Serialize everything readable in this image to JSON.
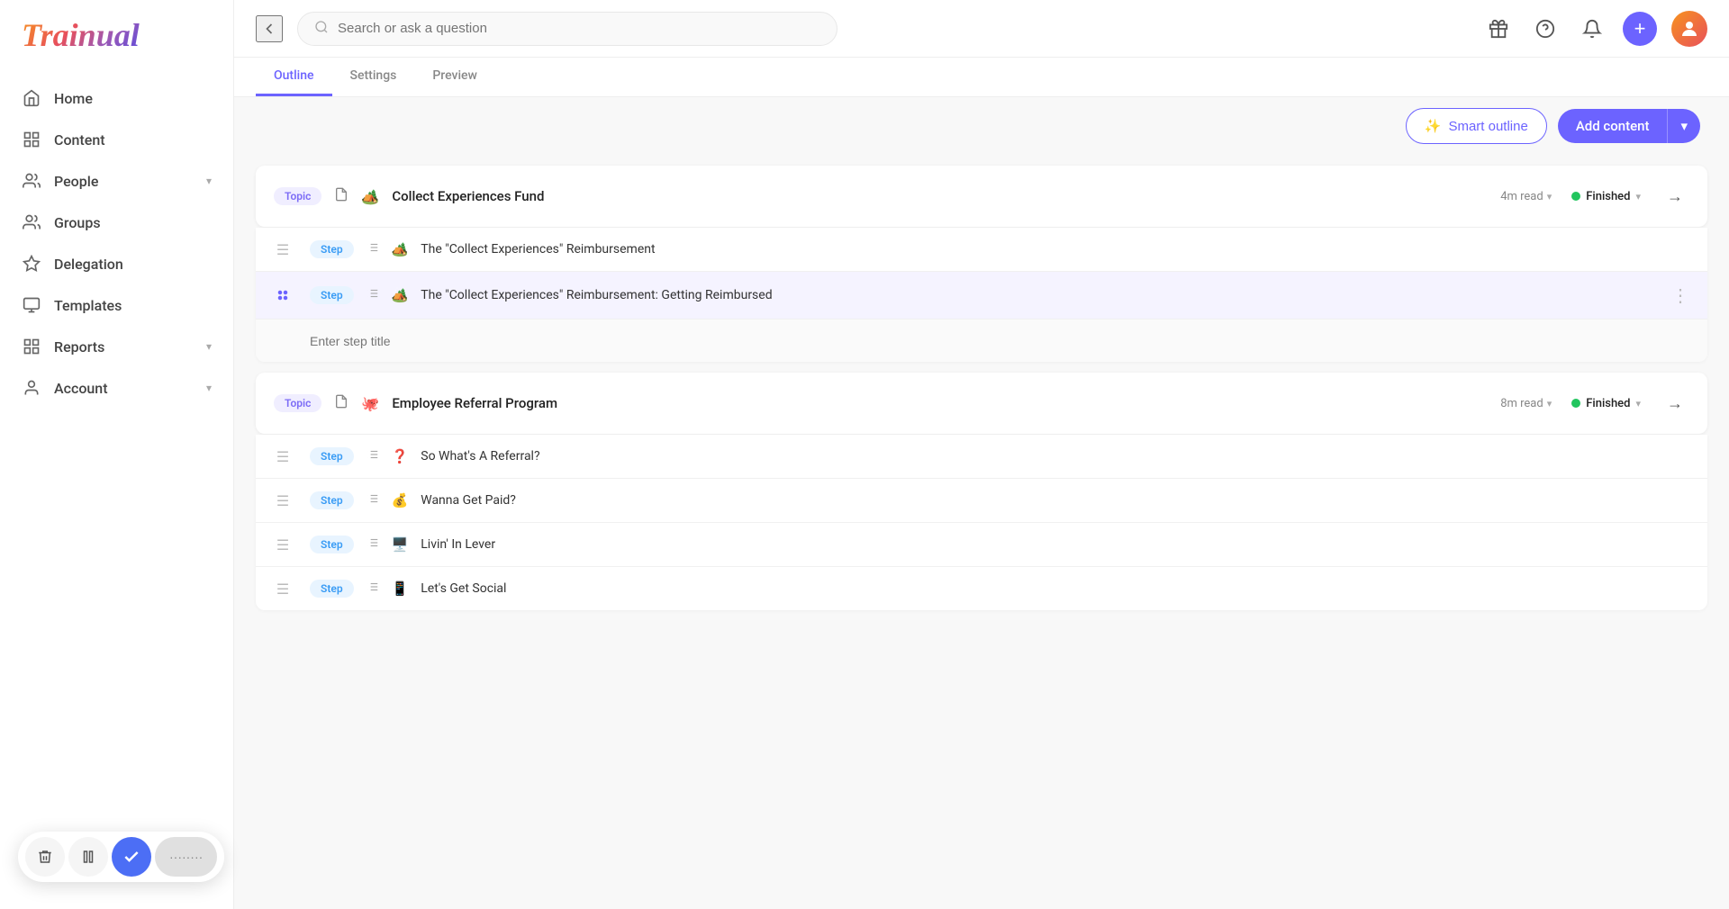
{
  "app": {
    "title": "Trainual",
    "logo": "Trainual"
  },
  "search": {
    "placeholder": "Search or ask a question"
  },
  "sidebar": {
    "items": [
      {
        "id": "home",
        "label": "Home",
        "icon": "home"
      },
      {
        "id": "content",
        "label": "Content",
        "icon": "content"
      },
      {
        "id": "people",
        "label": "People",
        "icon": "people",
        "hasArrow": true
      },
      {
        "id": "groups",
        "label": "Groups",
        "icon": "groups"
      },
      {
        "id": "delegation",
        "label": "Delegation",
        "icon": "delegation"
      },
      {
        "id": "templates",
        "label": "Templates",
        "icon": "templates"
      },
      {
        "id": "reports",
        "label": "Reports",
        "icon": "reports",
        "hasArrow": true
      },
      {
        "id": "account",
        "label": "Account",
        "icon": "account",
        "hasArrow": true
      }
    ]
  },
  "toolbar": {
    "smart_outline_label": "Smart outline",
    "add_content_label": "Add content"
  },
  "topics": [
    {
      "id": "topic1",
      "tag": "Topic",
      "emoji": "🏕️",
      "title": "Collect Experiences Fund",
      "read_time": "4m read",
      "status": "Finished",
      "steps": [
        {
          "tag": "Step",
          "emoji": "🏕️",
          "title": "The \"Collect Experiences\" Reimbursement",
          "highlighted": false
        },
        {
          "tag": "Step",
          "emoji": "🏕️",
          "title": "The \"Collect Experiences\" Reimbursement: Getting Reimbursed",
          "highlighted": true
        }
      ],
      "new_step_placeholder": "Enter step title"
    },
    {
      "id": "topic2",
      "tag": "Topic",
      "emoji": "🐙",
      "title": "Employee Referral Program",
      "read_time": "8m read",
      "status": "Finished",
      "steps": [
        {
          "tag": "Step",
          "emoji": "❓",
          "title": "So What's A Referral?",
          "highlighted": false
        },
        {
          "tag": "Step",
          "emoji": "💰",
          "title": "Wanna Get Paid?",
          "highlighted": false
        },
        {
          "tag": "Step",
          "emoji": "🖥️",
          "title": "Livin' In Lever",
          "highlighted": false
        },
        {
          "tag": "Step",
          "emoji": "📱",
          "title": "Let's Get Social",
          "highlighted": false
        }
      ],
      "new_step_placeholder": ""
    }
  ],
  "bottom_controls": {
    "trash_label": "",
    "pause_label": "",
    "check_label": "",
    "pill_label": "········"
  }
}
